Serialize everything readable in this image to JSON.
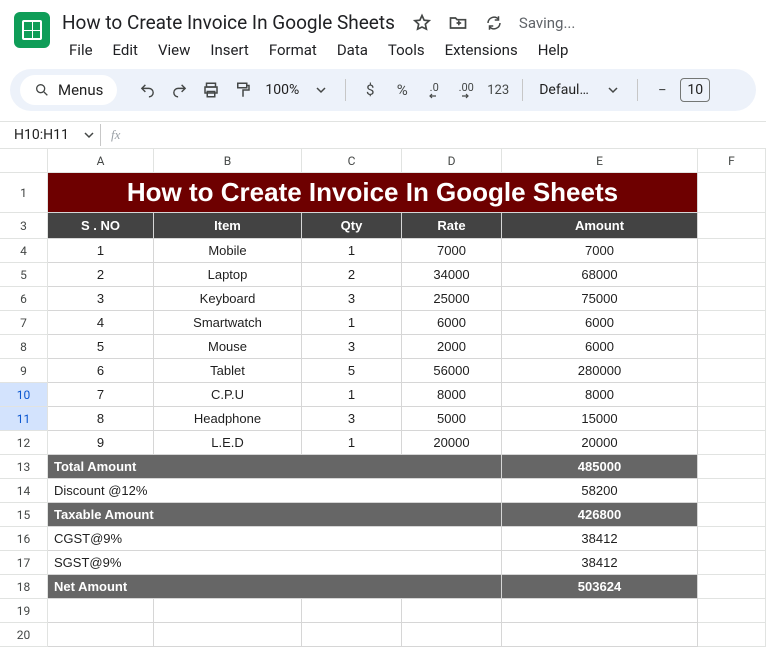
{
  "doc": {
    "title": "How to Create Invoice In Google Sheets",
    "saving": "Saving..."
  },
  "menu": {
    "file": "File",
    "edit": "Edit",
    "view": "View",
    "insert": "Insert",
    "format": "Format",
    "data": "Data",
    "tools": "Tools",
    "extensions": "Extensions",
    "help": "Help"
  },
  "toolbar": {
    "menus_chip": "Menus",
    "zoom": "100%",
    "currency_sym": "$",
    "percent_sym": "%",
    "dec_dec": ".0",
    "inc_dec": ".00",
    "num_fmt": "123",
    "font_name": "Defaul...",
    "minus": "−",
    "font_size": "10"
  },
  "name_box": "H10:H11",
  "fx": "fx",
  "columns": [
    "A",
    "B",
    "C",
    "D",
    "E",
    "F"
  ],
  "banner": "How to Create Invoice In Google Sheets",
  "headers": {
    "sno": "S . NO",
    "item": "Item",
    "qty": "Qty",
    "rate": "Rate",
    "amount": "Amount"
  },
  "rows": [
    {
      "n": 4,
      "sno": "1",
      "item": "Mobile",
      "qty": "1",
      "rate": "7000",
      "amount": "7000"
    },
    {
      "n": 5,
      "sno": "2",
      "item": "Laptop",
      "qty": "2",
      "rate": "34000",
      "amount": "68000"
    },
    {
      "n": 6,
      "sno": "3",
      "item": "Keyboard",
      "qty": "3",
      "rate": "25000",
      "amount": "75000"
    },
    {
      "n": 7,
      "sno": "4",
      "item": "Smartwatch",
      "qty": "1",
      "rate": "6000",
      "amount": "6000"
    },
    {
      "n": 8,
      "sno": "5",
      "item": "Mouse",
      "qty": "3",
      "rate": "2000",
      "amount": "6000"
    },
    {
      "n": 9,
      "sno": "6",
      "item": "Tablet",
      "qty": "5",
      "rate": "56000",
      "amount": "280000"
    },
    {
      "n": 10,
      "sno": "7",
      "item": "C.P.U",
      "qty": "1",
      "rate": "8000",
      "amount": "8000",
      "sel": true
    },
    {
      "n": 11,
      "sno": "8",
      "item": "Headphone",
      "qty": "3",
      "rate": "5000",
      "amount": "15000",
      "sel": true
    },
    {
      "n": 12,
      "sno": "9",
      "item": "L.E.D",
      "qty": "1",
      "rate": "20000",
      "amount": "20000"
    }
  ],
  "summary": [
    {
      "n": 13,
      "label": "Total Amount",
      "value": "485000",
      "dark": true
    },
    {
      "n": 14,
      "label": "Discount @12%",
      "value": "58200",
      "dark": false
    },
    {
      "n": 15,
      "label": "Taxable Amount",
      "value": "426800",
      "dark": true
    },
    {
      "n": 16,
      "label": "CGST@9%",
      "value": "38412",
      "dark": false
    },
    {
      "n": 17,
      "label": "SGST@9%",
      "value": "38412",
      "dark": false
    },
    {
      "n": 18,
      "label": "Net Amount",
      "value": "503624",
      "dark": true
    }
  ],
  "blank_rows": [
    19,
    20
  ]
}
